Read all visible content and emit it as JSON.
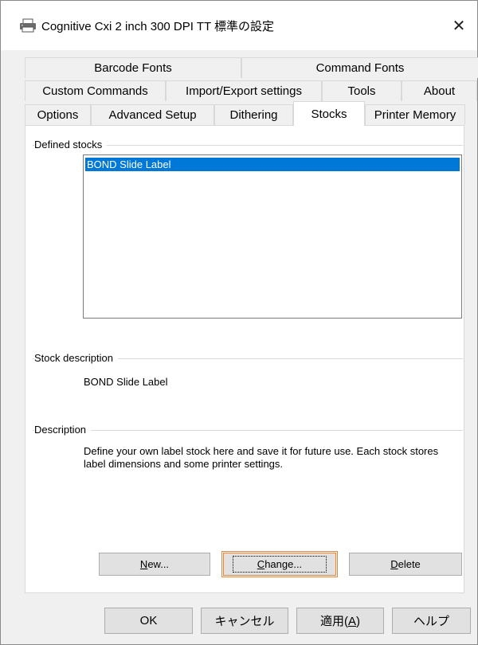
{
  "window": {
    "title": "Cognitive Cxi 2 inch 300 DPI TT 標準の設定",
    "close_glyph": "✕"
  },
  "tabs": {
    "row1": [
      "Barcode Fonts",
      "Command Fonts"
    ],
    "row2": [
      "Custom Commands",
      "Import/Export settings",
      "Tools",
      "About"
    ],
    "row3": [
      "Options",
      "Advanced Setup",
      "Dithering",
      "Stocks",
      "Printer Memory"
    ],
    "active": "Stocks"
  },
  "stocks": {
    "defined_label": "Defined stocks",
    "items": [
      "BOND Slide Label"
    ],
    "selected_index": 0,
    "stock_description_label": "Stock description",
    "stock_description_value": "BOND Slide Label",
    "description_label": "Description",
    "description_text": "Define your own label stock here and save it for future use. Each stock stores label dimensions and some printer settings.",
    "new_prefix": "",
    "new_underline": "N",
    "new_rest": "ew...",
    "change_underline": "C",
    "change_rest": "hange...",
    "delete_underline": "D",
    "delete_rest": "elete"
  },
  "footer": {
    "ok_label": "OK",
    "cancel_label": "キャンセル",
    "apply_main": "適用(",
    "apply_underline": "A",
    "apply_end": ")",
    "help_label": "ヘルプ"
  },
  "colors": {
    "selection": "#0078d7",
    "focus_border": "#e8853a"
  }
}
